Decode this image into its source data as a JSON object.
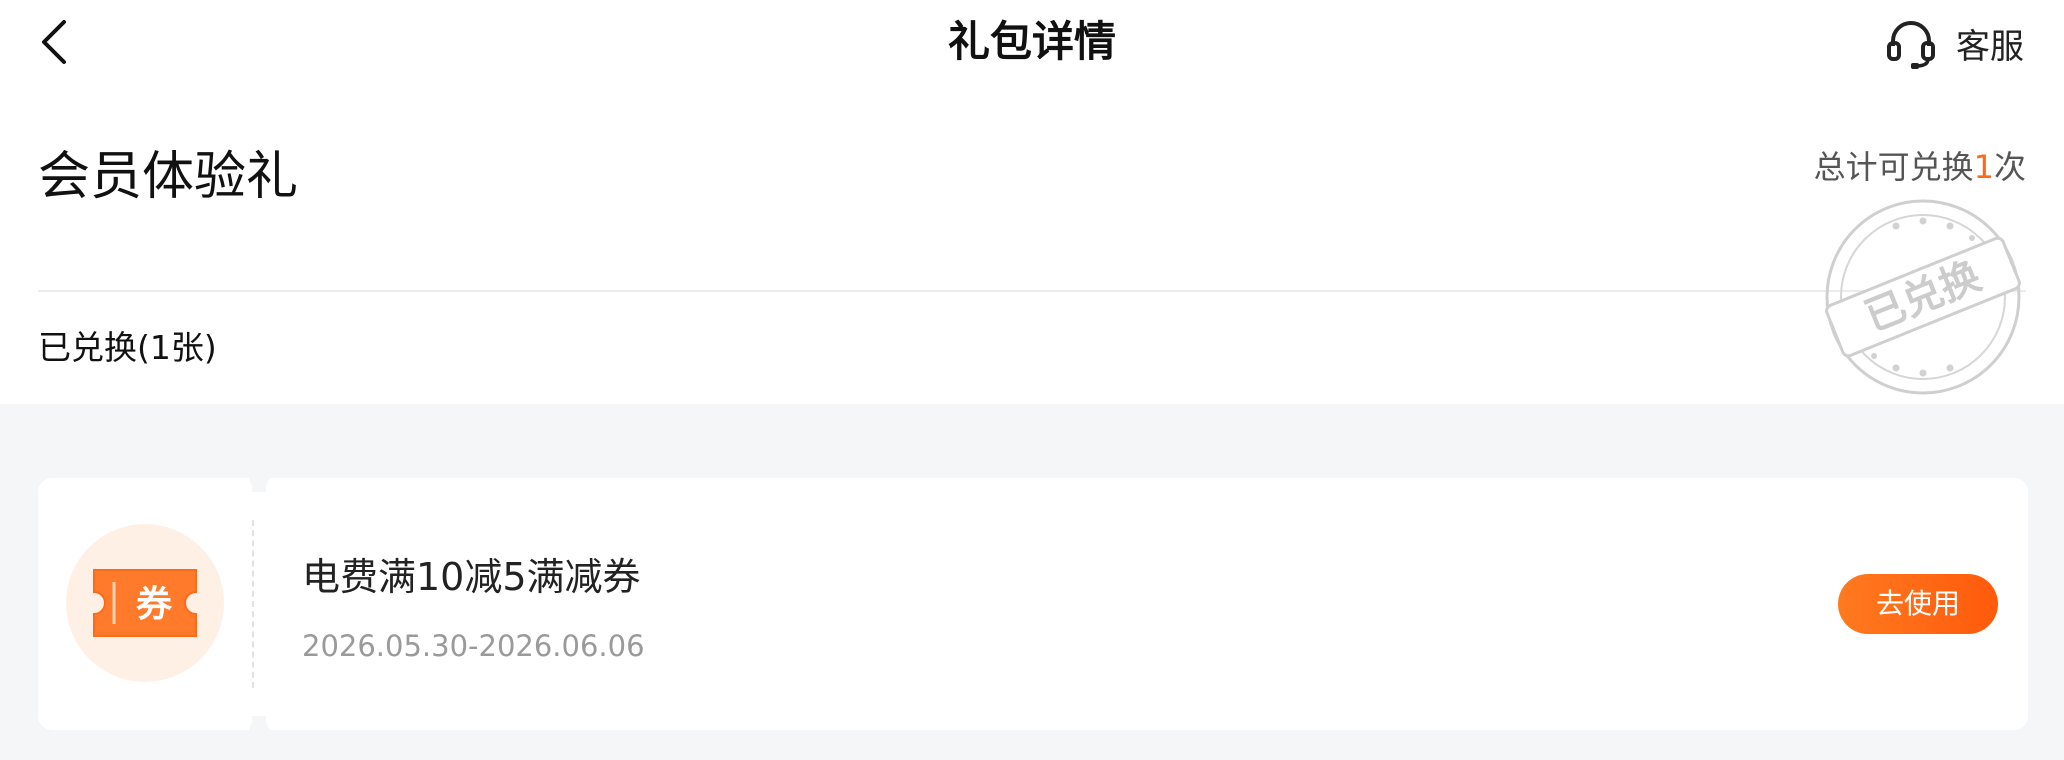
{
  "nav": {
    "title": "礼包详情",
    "service_label": "客服",
    "back_icon": "chevron-left-icon",
    "service_icon": "headset-icon"
  },
  "gift": {
    "title": "会员体验礼",
    "count_prefix": "总计可兑换",
    "count_value": "1",
    "count_suffix": "次",
    "redeemed_label": "已兑换(1张)",
    "stamp_text": "已兑换"
  },
  "coupon": {
    "icon_char": "券",
    "name": "电费满10减5满减券",
    "date_range": "2026.05.30-2026.06.06",
    "action_label": "去使用"
  },
  "colors": {
    "accent": "#ff6a1a",
    "page_background": "#f5f6f7",
    "stamp_gray": "#c8c8c8"
  }
}
